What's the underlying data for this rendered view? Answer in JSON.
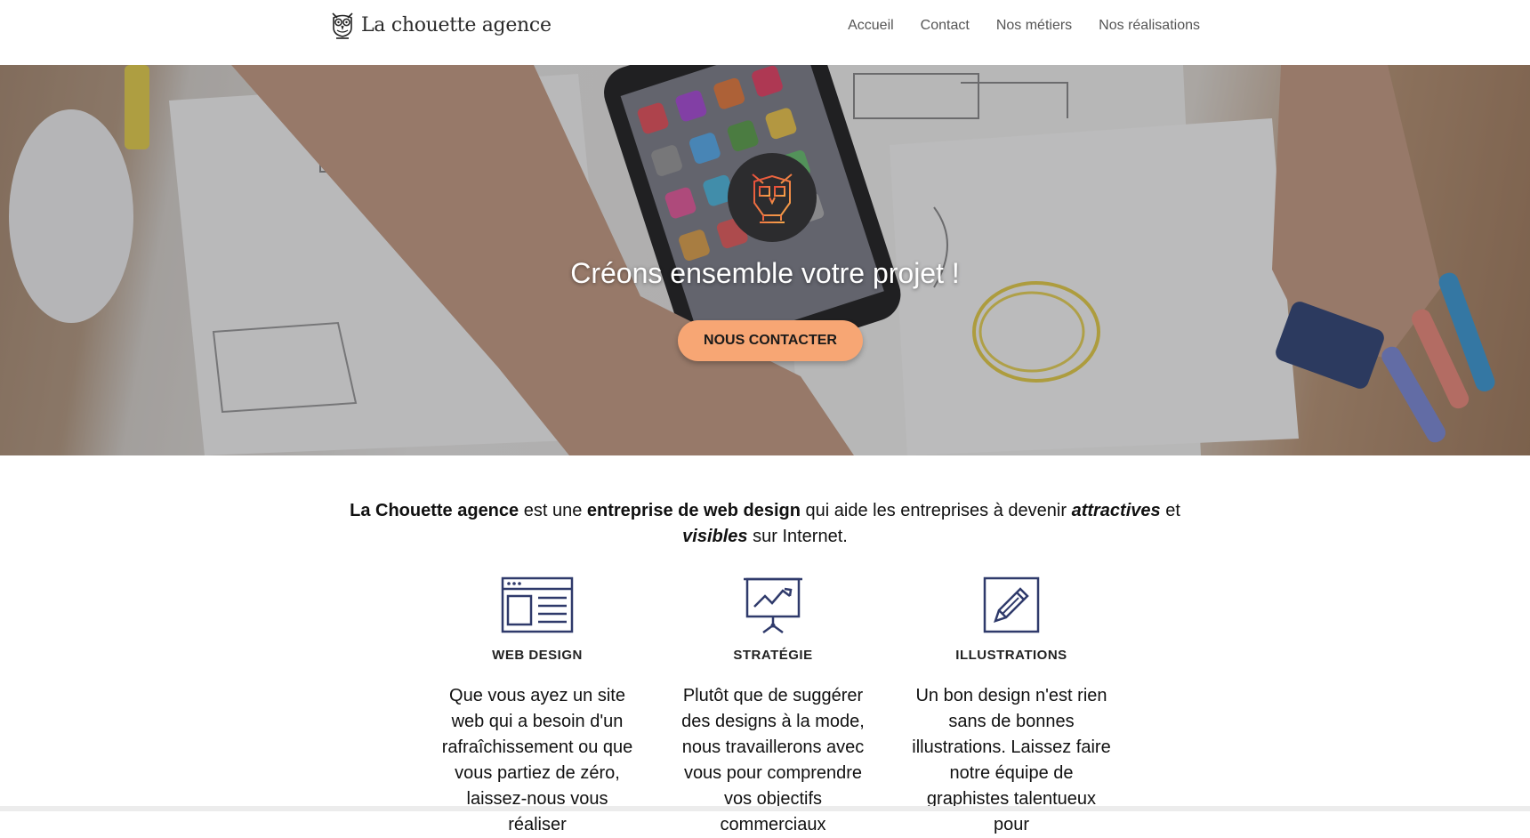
{
  "header": {
    "brand_name": "La chouette agence",
    "nav": [
      "Accueil",
      "Contact",
      "Nos métiers",
      "Nos réalisations"
    ]
  },
  "hero": {
    "title": "Créons ensemble votre projet !",
    "cta_label": "NOUS CONTACTER"
  },
  "intro": {
    "brand": "La Chouette agence",
    "t1": " est une ",
    "b1": "entreprise de web design",
    "t2": " qui aide les entreprises à devenir ",
    "e1": "attractives",
    "t3": " et ",
    "e2": "visibles",
    "t4": " sur Internet."
  },
  "services": [
    {
      "icon": "web-design-icon",
      "title": "WEB DESIGN",
      "text": "Que vous ayez un site web qui a besoin d'un rafraîchissement ou que vous partiez de zéro, laissez-nous vous réaliser"
    },
    {
      "icon": "strategy-icon",
      "title": "STRATÉGIE",
      "text": "Plutôt que de suggérer des designs à la mode, nous travaillerons avec vous pour comprendre vos objectifs commerciaux"
    },
    {
      "icon": "illustration-icon",
      "title": "ILLUSTRATIONS",
      "text": "Un bon design n'est rien sans de bonnes illustrations. Laissez faire notre équipe de graphistes talentueux pour"
    }
  ],
  "colors": {
    "accent": "#f7a674",
    "icon_navy": "#2f3a6b",
    "emblem_bg": "#2c2c2e"
  }
}
